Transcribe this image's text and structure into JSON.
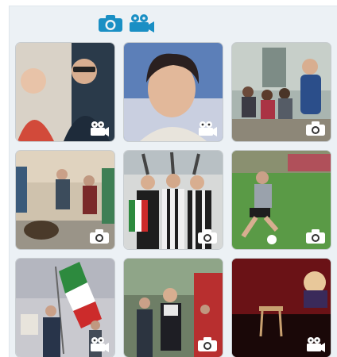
{
  "toolbar": {
    "photo_icon": "camera-icon",
    "video_icon": "video-camera-icon",
    "accent": "#1a8fc4"
  },
  "gallery": {
    "items": [
      {
        "type": "video",
        "icon": "video-camera-icon",
        "scene": "two-people-portrait"
      },
      {
        "type": "video",
        "icon": "video-camera-icon",
        "scene": "woman-closeup"
      },
      {
        "type": "photo",
        "icon": "camera-icon",
        "scene": "crowd-seated-speaker"
      },
      {
        "type": "photo",
        "icon": "camera-icon",
        "scene": "street-planting"
      },
      {
        "type": "photo",
        "icon": "camera-icon",
        "scene": "fans-with-flags"
      },
      {
        "type": "photo",
        "icon": "camera-icon",
        "scene": "football-player"
      },
      {
        "type": "video",
        "icon": "video-camera-icon",
        "scene": "march-with-flag"
      },
      {
        "type": "photo",
        "icon": "camera-icon",
        "scene": "street-speaker"
      },
      {
        "type": "video",
        "icon": "video-camera-icon",
        "scene": "stage-event"
      }
    ]
  }
}
